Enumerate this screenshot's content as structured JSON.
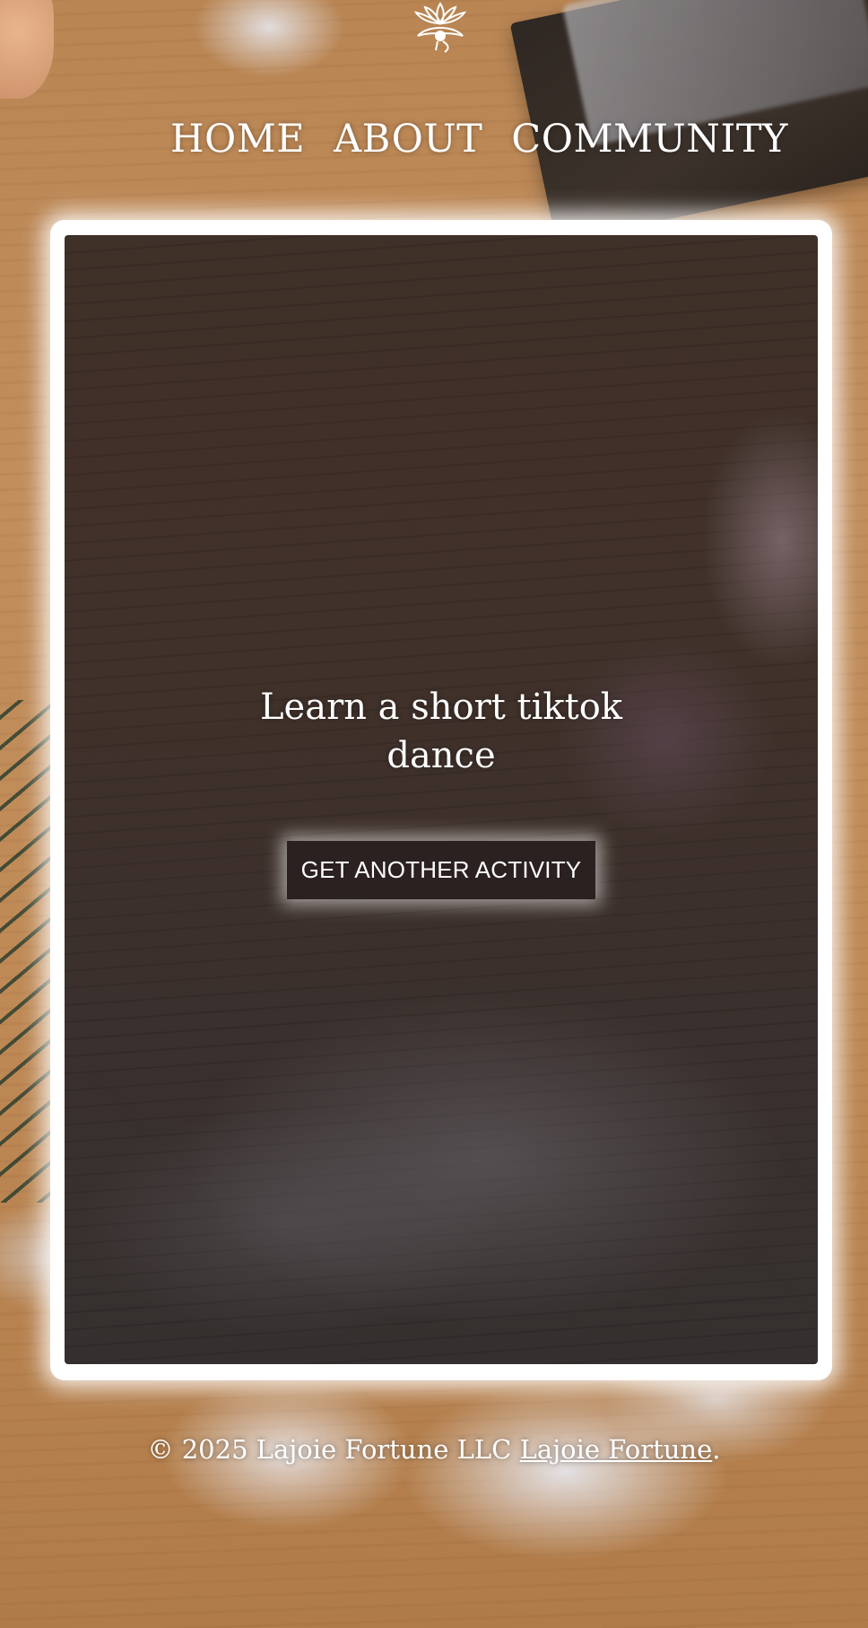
{
  "nav": {
    "items": [
      {
        "label": "HOME"
      },
      {
        "label": "ABOUT"
      },
      {
        "label": "COMMUNITY"
      }
    ]
  },
  "logo": {
    "icon": "lotus-eye-icon"
  },
  "main": {
    "activity": "Learn a short tiktok dance",
    "button_label": "GET ANOTHER ACTIVITY"
  },
  "footer": {
    "copyright": "© 2025 Lajoie Fortune LLC",
    "link_label": "Lajoie Fortune",
    "suffix": "."
  },
  "colors": {
    "card_border": "#ffffff",
    "button_bg": "#2a2120",
    "text": "#ffffff"
  }
}
